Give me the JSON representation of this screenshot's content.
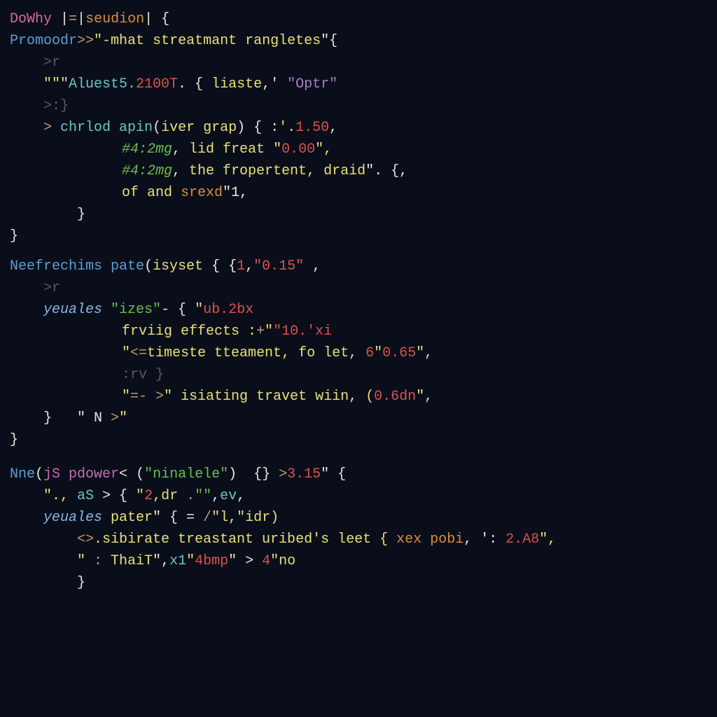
{
  "lines": {
    "l1": {
      "a": "DoWhy",
      "b": " |",
      "c": "=",
      "d": "|",
      "e": "seudion",
      "f": "| {"
    },
    "l2": {
      "a": "Promoodr",
      "b": ">>",
      "c": "\"",
      "d": "-mhat streatmant rangletes",
      "e": "\"{"
    },
    "l3": {
      "a": ">r"
    },
    "l4": {
      "a": "\"\"\"",
      "b": "Aluest5.",
      "c": "2100T",
      "d": ". { ",
      "e": "liaste",
      "f": ",' ",
      "g": "\"Optr\""
    },
    "l5": {
      "a": ">:}"
    },
    "l6": {
      "a": "> ",
      "b": "chrlod apin",
      "c": "(",
      "d": "iver grap",
      "e": ") { :",
      "f": "'.",
      "g": "1.50",
      "h": ","
    },
    "l7": {
      "a": "#4:2mg",
      "b": ", ",
      "c": "lid freat ",
      "d": "\"",
      "e": "0.00",
      "f": "\","
    },
    "l8": {
      "a": "#4:2mg",
      "b": ", ",
      "c": "the fropertent, draid",
      "d": "\". {,"
    },
    "l9": {
      "a": "of and ",
      "b": "srexd",
      "c": "\"1,"
    },
    "l10": {
      "a": "}"
    },
    "l11": {
      "a": "}"
    },
    "l12": {
      "a": "Neefrechims pate",
      "b": "(",
      "c": "isyset",
      "d": " { {",
      "e": "1",
      "f": ",",
      "g": "\"0.15\"",
      "h": " ,"
    },
    "l13": {
      "a": ">r"
    },
    "l14": {
      "a": "yeuales",
      "b": " ",
      "c": "\"izes\"",
      "d": "- { ",
      "e": "\"",
      "f": "ub.2bx"
    },
    "l15": {
      "a": "frviig effects :",
      "b": "+",
      "c": "\"",
      "d": "\"10.'xi"
    },
    "l16": {
      "a": "\"",
      "b": "<=",
      "c": "timeste tteament, fo let, ",
      "d": "6",
      "e": "\"",
      "f": "0.65",
      "g": "\","
    },
    "l17": {
      "a": ":rv }"
    },
    "l18": {
      "a": "\"",
      "b": "=- >",
      "c": "\" isiating travet wiin, (",
      "d": "0.6dn",
      "e": "\","
    },
    "l19": {
      "a": "}   \" N ",
      "b": ">",
      "c": "\""
    },
    "l20": {
      "a": "}"
    },
    "l21": {
      "a": "Nne",
      "b": "(",
      "c": "jS pdower",
      "d": "< (",
      "e": "\"ninalele\"",
      "f": ")  {} ",
      "g": ">",
      "h": "3.15",
      "i": "\" {"
    },
    "l22": {
      "a": "\"., ",
      "b": "aS",
      "c": " > { ",
      "d": "\"",
      "e": "2",
      "f": ",dr ",
      "g": ".\"\"",
      "h": ",",
      "i": "ev",
      "j": ","
    },
    "l23": {
      "a": "yeuales",
      "b": " pater",
      "c": "\" { = ",
      "d": "/",
      "e": "\"l,\"idr)"
    },
    "l24": {
      "a": "<>",
      "b": ".sibirate treastant uribed's leet { ",
      "c": "xex pobi",
      "d": ", ':",
      "e": " 2.A8",
      "f": "\","
    },
    "l25": {
      "a": "\" ",
      "b": ":",
      "c": " ThaiT",
      "d": "\",",
      "e": "x1",
      "f": "\"",
      "g": "4bmp",
      "h": "\" > ",
      "i": "4",
      "j": "\"",
      "k": "no"
    },
    "l26": {
      "a": "}"
    }
  }
}
